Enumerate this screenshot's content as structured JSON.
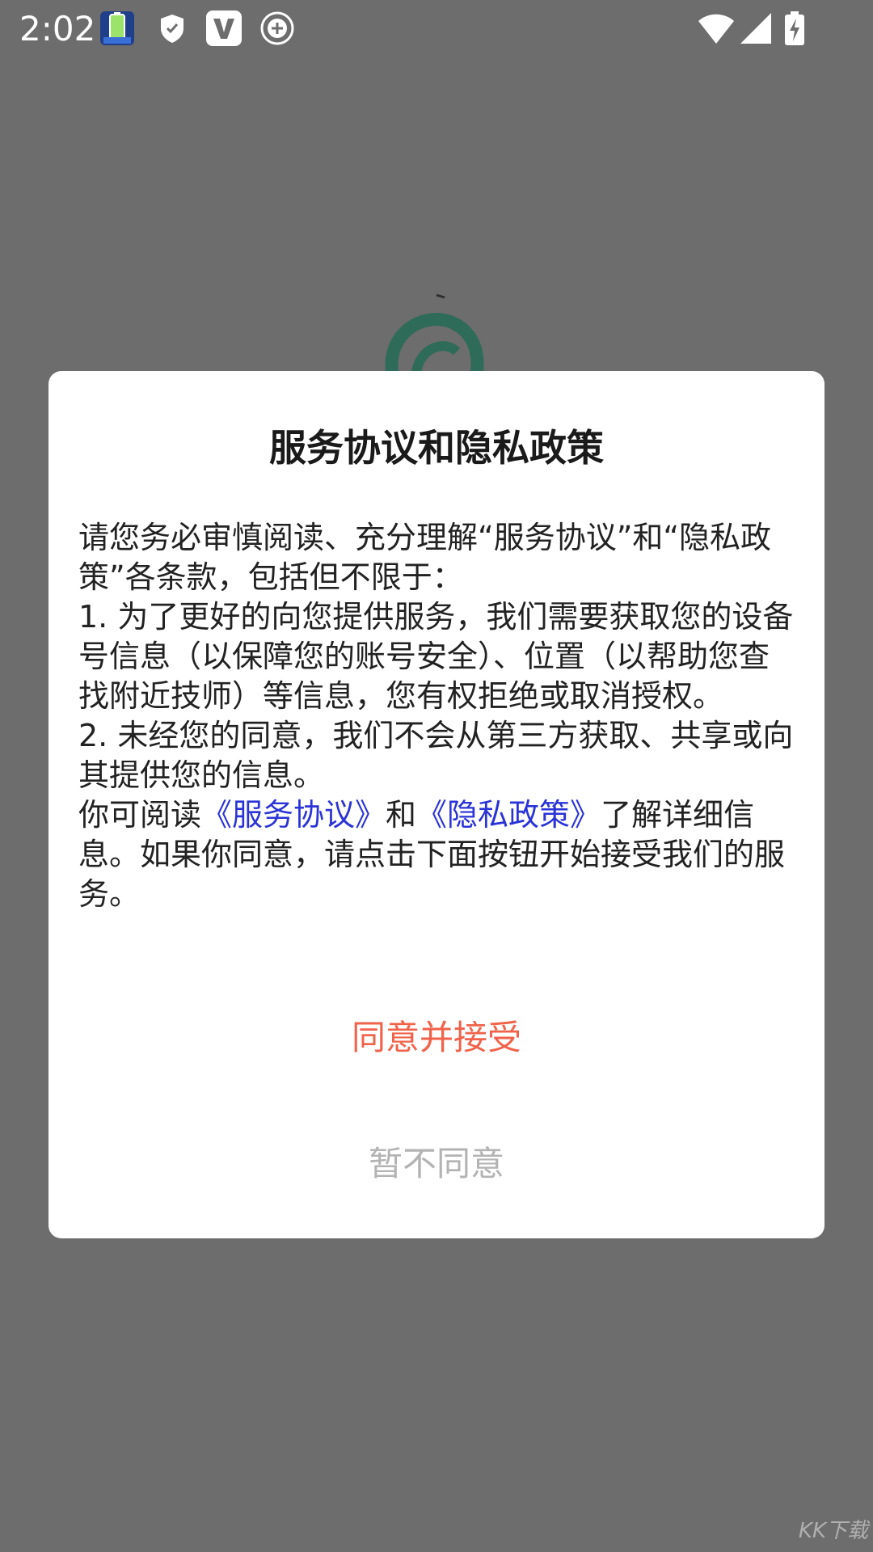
{
  "status_bar": {
    "time": "2:02",
    "left_icons": [
      "battery-app-icon",
      "shield-icon",
      "v-app-icon",
      "add-circle-icon"
    ],
    "right_icons": [
      "wifi-icon",
      "signal-icon",
      "battery-charging-icon"
    ]
  },
  "dialog": {
    "title": "服务协议和隐私政策",
    "paragraph_intro": "请您务必审慎阅读、充分理解“服务协议”和“隐私政策”各条款，包括但不限于：",
    "item_1": "1. 为了更好的向您提供服务，我们需要获取您的设备号信息（以保障您的账号安全）、位置（以帮助您查找附近技师）等信息，您有权拒绝或取消授权。",
    "item_2": "2. 未经您的同意，我们不会从第三方获取、共享或向其提供您的信息。",
    "read_prefix": "你可阅读",
    "service_link": "《服务协议》",
    "and_text": "和",
    "privacy_link": "《隐私政策》",
    "read_suffix": "了解详细信息。如果你同意，请点击下面按钮开始接受我们的服务。",
    "agree_button": "同意并接受",
    "decline_button": "暂不同意"
  },
  "watermark": "KK下载",
  "colors": {
    "overlay_background": "#6d6d6d",
    "link": "#2a33d6",
    "agree": "#f0624a",
    "decline": "#b3b3b3"
  }
}
